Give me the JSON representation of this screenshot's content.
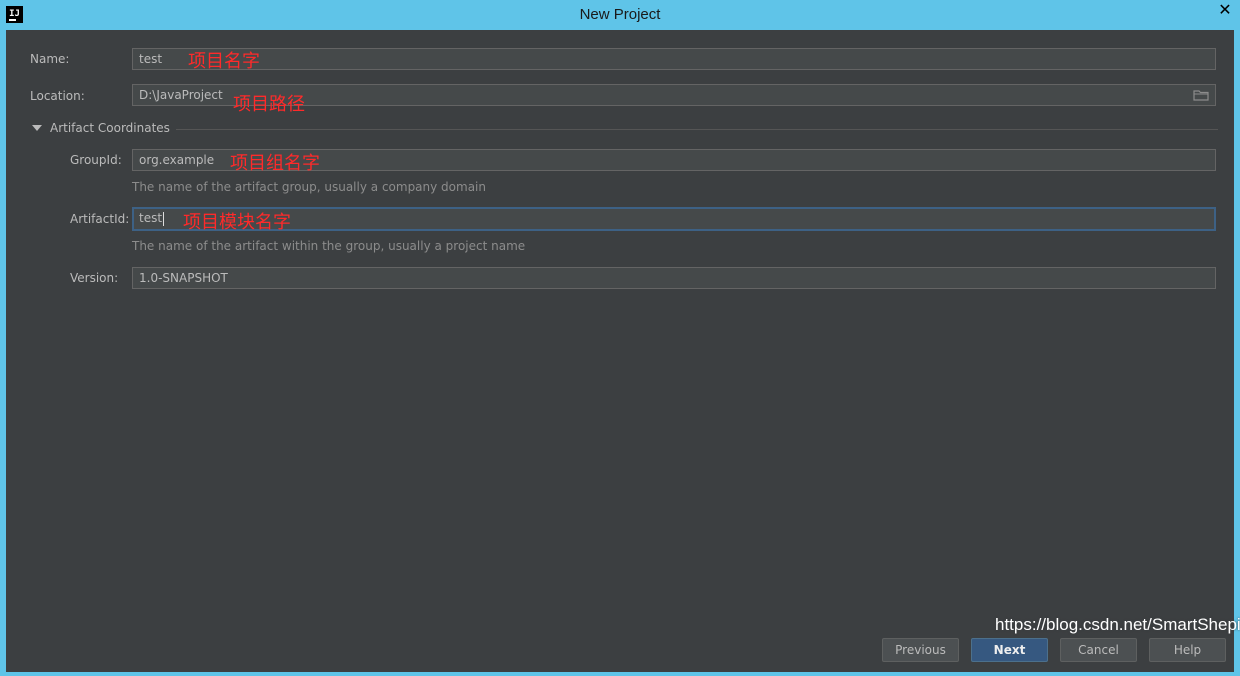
{
  "window": {
    "title": "New Project",
    "close_symbol": "✕"
  },
  "form": {
    "name": {
      "label": "Name:",
      "value": "test",
      "annotation": "项目名字"
    },
    "location": {
      "label": "Location:",
      "value": "D:\\JavaProject",
      "annotation": "项目路径",
      "browse_icon": "folder-icon"
    },
    "artifact_section": {
      "label": "Artifact Coordinates",
      "expanded": true
    },
    "group_id": {
      "label": "GroupId:",
      "value": "org.example",
      "annotation": "项目组名字",
      "hint": "The name of the artifact group, usually a company domain"
    },
    "artifact_id": {
      "label": "ArtifactId:",
      "value": "test",
      "annotation": "项目模块名字",
      "hint": "The name of the artifact within the group, usually a project name"
    },
    "version": {
      "label": "Version:",
      "value": "1.0-SNAPSHOT"
    }
  },
  "buttons": {
    "previous": "Previous",
    "next": "Next",
    "cancel": "Cancel",
    "help": "Help"
  },
  "watermark": "https://blog.csdn.net/SmartShepi",
  "colors": {
    "titlebar": "#5fc4e8",
    "background": "#3c3f41",
    "field": "#45494a",
    "focus_border": "#3d6185",
    "annotation": "#ff2a2a",
    "primary_button": "#365880"
  }
}
